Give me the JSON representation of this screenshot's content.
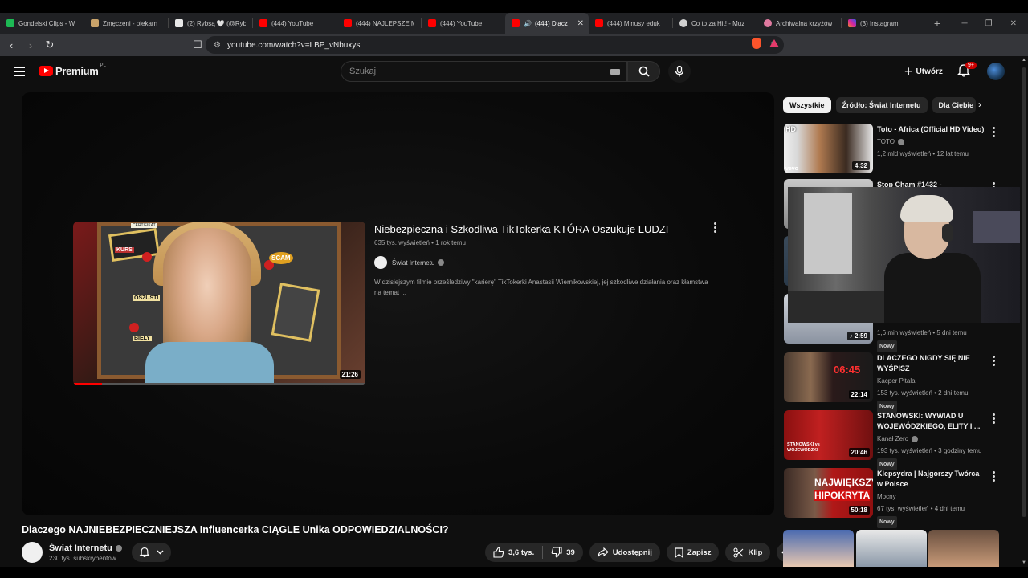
{
  "browser": {
    "tabs": [
      {
        "label": "Gondelski Clips - W",
        "color": "#1db954",
        "active": false
      },
      {
        "label": "Zmęczeni - piekarn",
        "color": "#c9a36a",
        "active": false
      },
      {
        "label": "(2) Rybsą 🤍 (@Ryb",
        "color": "#e8e8e8",
        "active": false
      },
      {
        "label": "(444) YouTube",
        "color": "#ff0000",
        "active": false
      },
      {
        "label": "(444) NAJLEPSZE M",
        "color": "#ff0000",
        "active": false
      },
      {
        "label": "(444) YouTube",
        "color": "#ff0000",
        "active": false
      },
      {
        "label": "(444) Dlacz",
        "color": "#ff0000",
        "active": true
      },
      {
        "label": "(444) Minusy eduk",
        "color": "#ff0000",
        "active": false
      },
      {
        "label": "Co to za Hit! - Muz",
        "color": "#d0d0d0",
        "active": false
      },
      {
        "label": "Archiwalna krzyżów",
        "color": "#e07aa0",
        "active": false
      },
      {
        "label": "(3) Instagram",
        "color": "#d6249f",
        "active": false
      }
    ],
    "url": "youtube.com/watch?v=LBP_vNbuxys"
  },
  "masthead": {
    "brand": "Premium",
    "country": "PL",
    "search_placeholder": "Szukaj",
    "create_label": "Utwórz",
    "notif_count": "9+"
  },
  "endscreen": {
    "title": "Niebezpieczna i Szkodliwa TikTokerka KTÓRA Oszukuje LUDZI",
    "meta": "635 tys. wyświetleń • 1 rok temu",
    "channel": "Świat Internetu",
    "description": "W dzisiejszym filmie prześledziwy \"karierę\" TikTokerki Anastasii Wiernikowskiej, jej szkodliwe działania oraz kłamstwa na temat ...",
    "duration": "21:26",
    "thumb_labels": {
      "a": "KURS",
      "b": "SCAM",
      "c": "OSZUSTI",
      "d": "CERTIFIKAT",
      "e": "BIELY"
    },
    "progress_fraction": 0.1
  },
  "video": {
    "title": "Dlaczego NAJNIEBEZPIECZNIEJSZA Influencerka CIĄGLE Unika ODPOWIEDZIALNOŚCI?",
    "channel": "Świat Internetu",
    "subscribers": "230 tys. subskrybentów",
    "likes": "3,6 tys.",
    "dislikes": "39",
    "share_label": "Udostępnij",
    "save_label": "Zapisz",
    "clip_label": "Klip"
  },
  "chips": [
    "Wszystkie",
    "Źródło: Świat Internetu",
    "Dla Ciebie"
  ],
  "recommendations": [
    {
      "title": "Toto - Africa (Official HD Video)",
      "channel": "TOTO",
      "meta": "1,2 mld wyświetleń • 12 lat temu",
      "duration": "4:32",
      "badge": "",
      "thumb_text": "HD",
      "thumb_text2": "vevo"
    },
    {
      "title": "Stop Cham #1432 -",
      "channel": "",
      "meta": "",
      "duration": "",
      "badge": "",
      "thumb_text": "",
      "thumb_text2": ""
    },
    {
      "title": "",
      "channel": "",
      "meta": "1,6 min wyświetleń • 5 dni temu",
      "duration": "2:59",
      "badge": "Nowy",
      "thumb_text": "",
      "thumb_text2": ""
    },
    {
      "title": "DLACZEGO NIGDY SIĘ NIE WYŚPISZ",
      "channel": "Kacper Pitala",
      "meta": "153 tys. wyświetleń • 2 dni temu",
      "duration": "22:14",
      "badge": "Nowy",
      "thumb_text": "06:45",
      "thumb_text2": ""
    },
    {
      "title": "STANOWSKI: WYWIAD U WOJEWÓDZKIEGO, ELITY I ...",
      "channel": "Kanał Zero",
      "meta": "193 tys. wyświetleń • 3 godziny temu",
      "duration": "20:46",
      "badge": "Nowy",
      "thumb_text": "STANOWSKI vs WOJEWÓDZKI",
      "thumb_text2": ""
    },
    {
      "title": "Klepsydra | Najgorszy Twórca w Polsce",
      "channel": "Mocny",
      "meta": "67 tys. wyświetleń • 4 dni temu",
      "duration": "50:18",
      "badge": "Nowy",
      "thumb_text": "NAJWIĘKSZY",
      "thumb_text2": "HIPOKRYTA"
    }
  ],
  "colors": {
    "accent": "#ff0000",
    "bg": "#0f0f0f",
    "chip": "#272727"
  }
}
